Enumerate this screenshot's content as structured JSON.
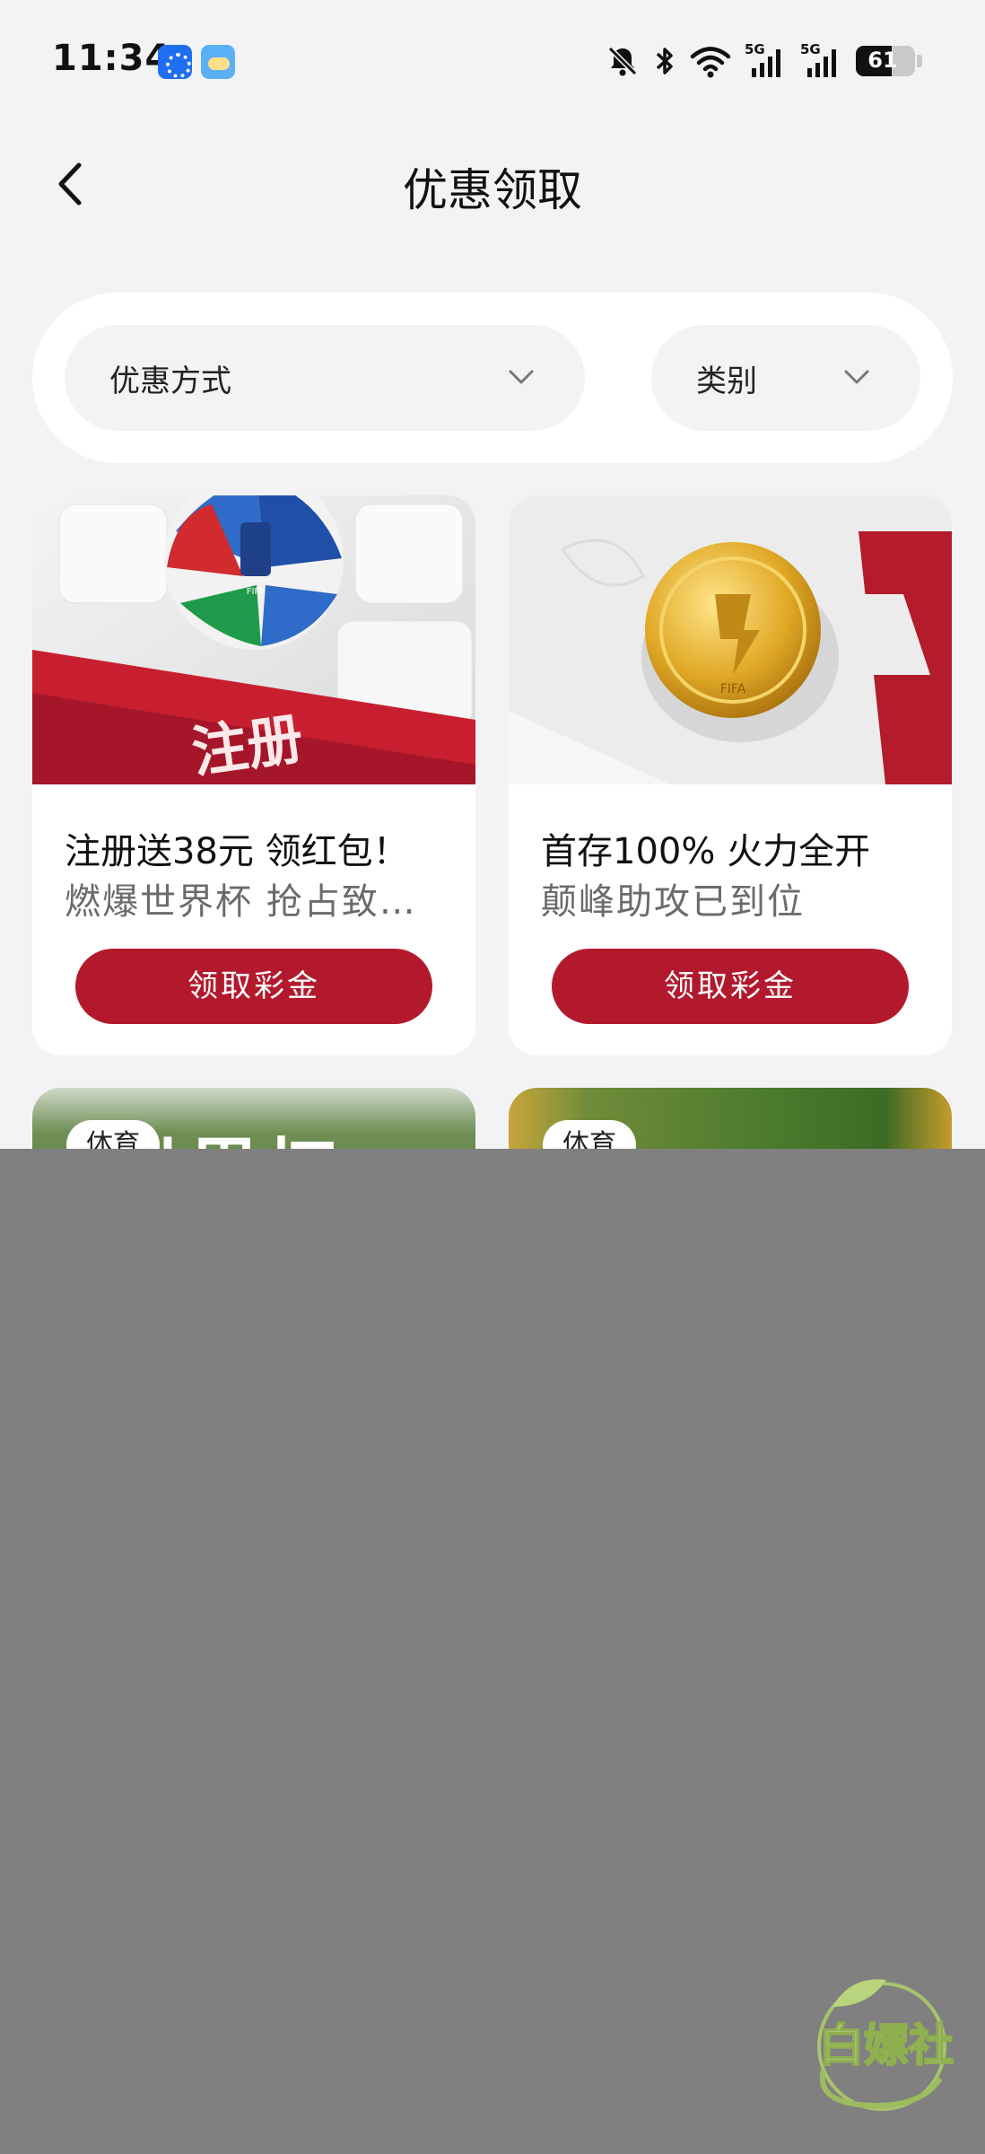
{
  "status_bar": {
    "time": "11:34",
    "battery_level": "61",
    "battery_percent": 61,
    "network": "5G",
    "icons": [
      "app-icon-blue",
      "weather-icon",
      "bell-off-icon",
      "bluetooth-icon",
      "wifi-icon",
      "signal-5g-icon",
      "signal-5g-icon",
      "battery-icon"
    ]
  },
  "header": {
    "title": "优惠领取",
    "back_icon": "chevron-left-icon"
  },
  "filters": {
    "method_label": "优惠方式",
    "category_label": "类别",
    "dropdown_icon": "chevron-down-icon"
  },
  "cards": [
    {
      "image_text": "注册",
      "title": "注册送38元 领红包！",
      "subtitle": "燃爆世界杯 抢占致…",
      "button": "领取彩金"
    },
    {
      "title": "首存100%  火力全开",
      "subtitle": "颠峰助攻已到位",
      "button": "领取彩金"
    }
  ],
  "partial_cards": [
    {
      "badge": "体育",
      "image_text": "世界杯"
    },
    {
      "badge": "体育"
    }
  ],
  "watermark": {
    "text": "白嫖社"
  },
  "colors": {
    "accent": "#b3192d",
    "background": "#f3f3f5",
    "overlay": "#808080"
  }
}
